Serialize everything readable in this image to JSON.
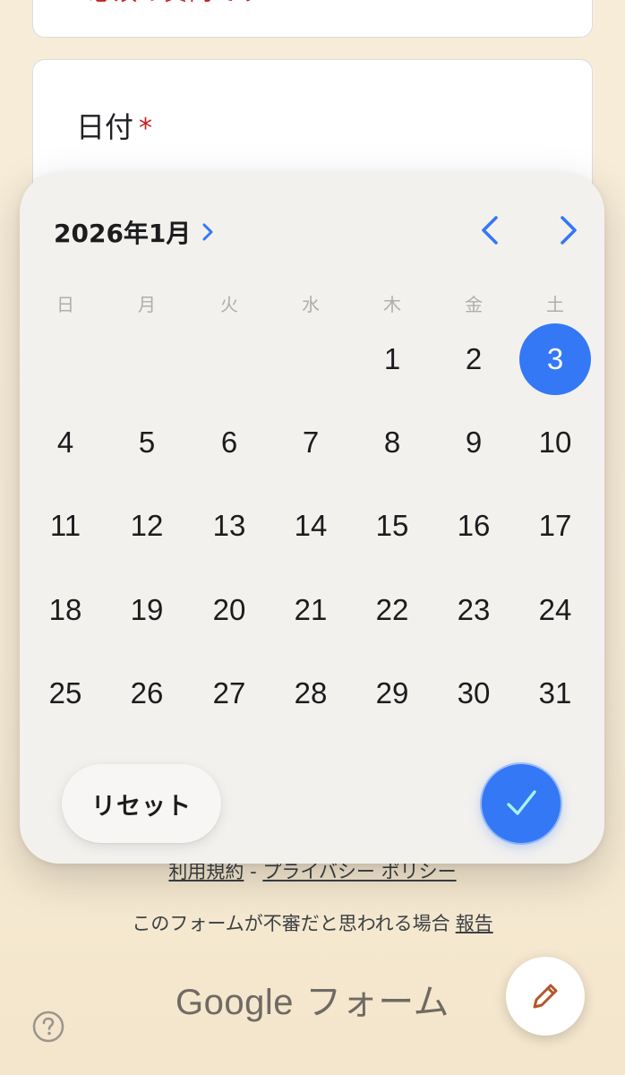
{
  "form": {
    "top_card_text": "必須の質問です",
    "date_question_label": "日付",
    "required_marker": "*"
  },
  "date_picker": {
    "month_title": "2026年1月",
    "weekdays": [
      "日",
      "月",
      "火",
      "水",
      "木",
      "金",
      "土"
    ],
    "days": [
      "1",
      "2",
      "3",
      "4",
      "5",
      "6",
      "7",
      "8",
      "9",
      "10",
      "11",
      "12",
      "13",
      "14",
      "15",
      "16",
      "17",
      "18",
      "19",
      "20",
      "21",
      "22",
      "23",
      "24",
      "25",
      "26",
      "27",
      "28",
      "29",
      "30",
      "31"
    ],
    "first_weekday_index": 4,
    "selected_day": "3",
    "reset_label": "リセット",
    "accent_color": "#3478f6",
    "icons": {
      "month_expand": "chevron-right-icon",
      "prev": "chevron-left-icon",
      "next": "chevron-right-icon",
      "confirm": "checkmark-icon"
    }
  },
  "footer": {
    "terms_label": "利用規約",
    "separator": " - ",
    "privacy_label": "プライバシー ポリシー",
    "report_prefix": "このフォームが不審だと思われる場合",
    "report_link": "報告",
    "brand_google": "Google",
    "brand_forms": " フォーム"
  },
  "icons": {
    "help": "help-icon",
    "edit": "pencil-icon"
  }
}
